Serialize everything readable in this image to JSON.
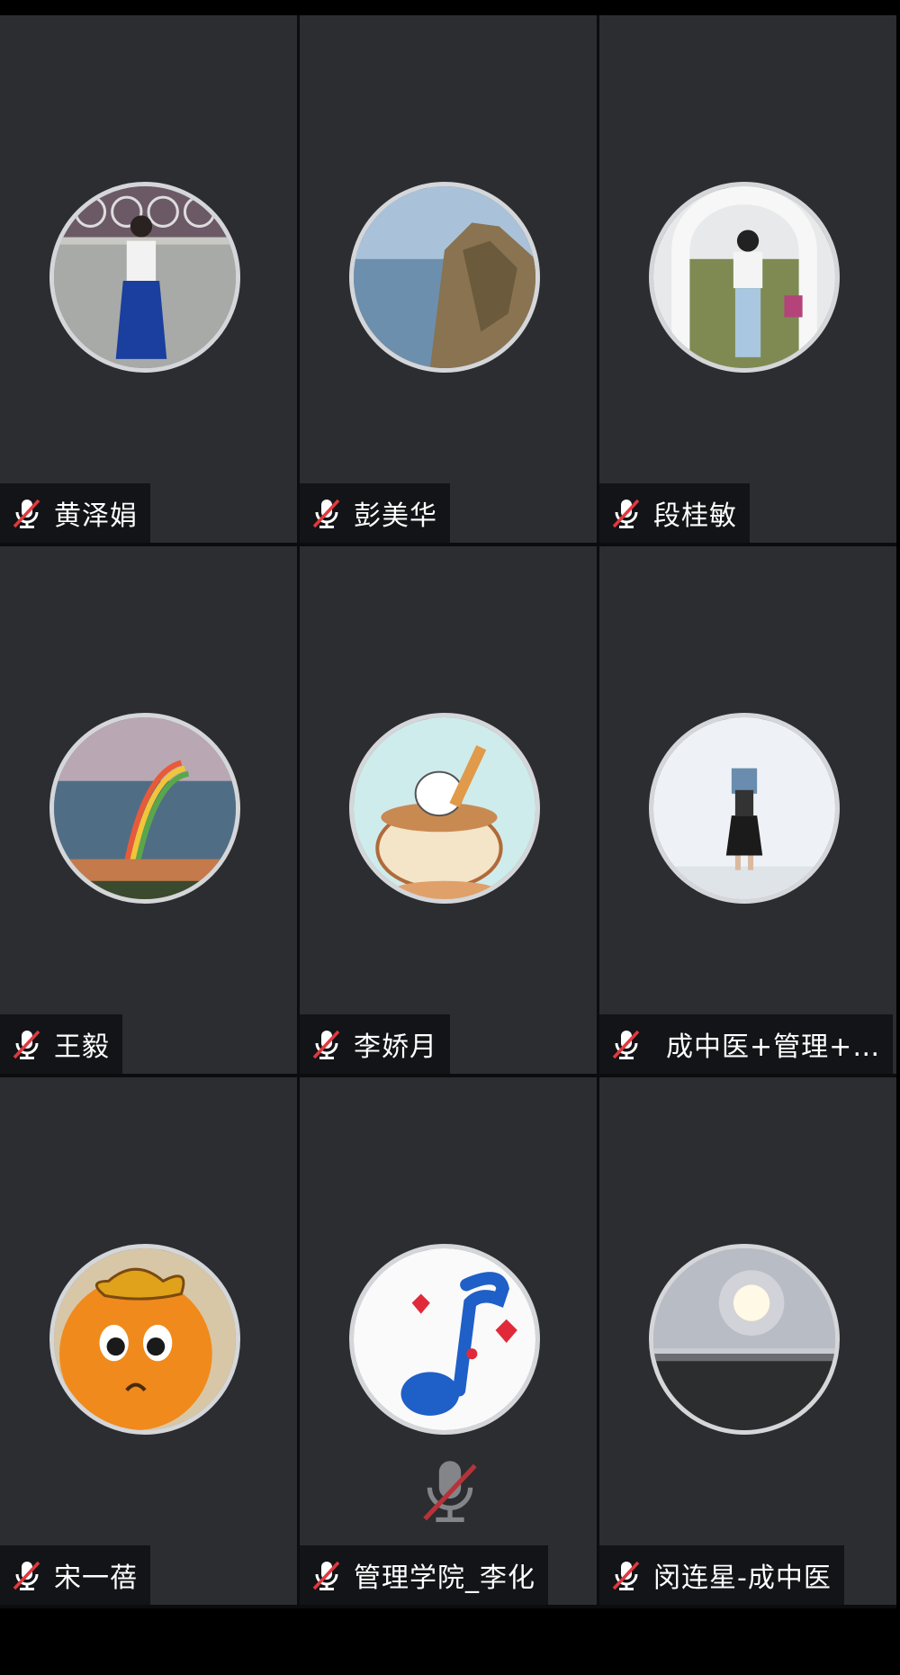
{
  "participants": [
    {
      "name": "黄泽娟",
      "muted": true,
      "avatar": "photo-woman-blue-skirt"
    },
    {
      "name": "彭美华",
      "muted": true,
      "avatar": "photo-cliff-lake"
    },
    {
      "name": "段桂敏",
      "muted": true,
      "avatar": "photo-woman-arch"
    },
    {
      "name": "王毅",
      "muted": true,
      "avatar": "photo-rainbow"
    },
    {
      "name": "李娇月",
      "muted": true,
      "avatar": "cartoon-rabbit-coffee"
    },
    {
      "name": "成中医+管理+…",
      "muted": true,
      "avatar": "photo-woman-white-wall"
    },
    {
      "name": "宋一蓓",
      "muted": true,
      "avatar": "pumpkin-face"
    },
    {
      "name": "管理学院_李化",
      "muted": true,
      "avatar": "music-note"
    },
    {
      "name": "闵连星-成中医",
      "muted": true,
      "avatar": "photo-sun-sea"
    }
  ],
  "colors": {
    "tile_bg": "#2b2d30",
    "label_bg": "#101113",
    "mute_red": "#e0383e",
    "avatar_ring": "#d4d6d9"
  }
}
